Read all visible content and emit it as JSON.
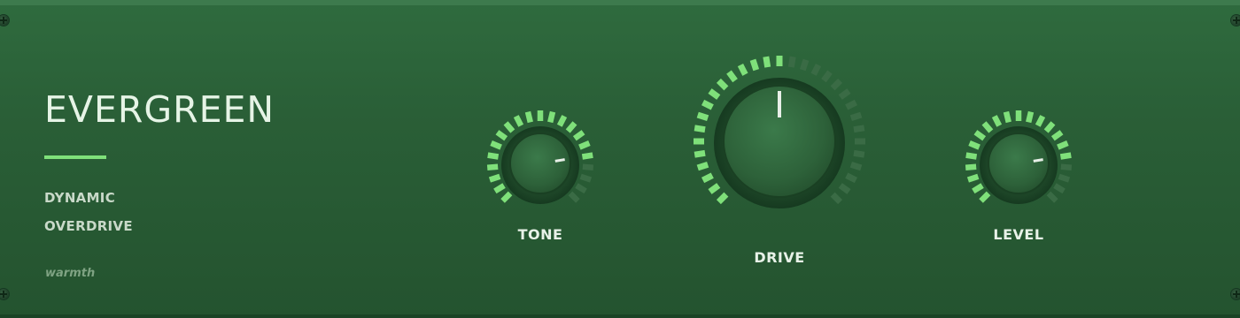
{
  "plugin": {
    "name": "EVERGREEN",
    "subtitle_line1": "DYNAMIC",
    "subtitle_line2": "OVERDRIVE",
    "tag": "warmth"
  },
  "colors": {
    "panel": "#2a5f37",
    "accent": "#7fe07a",
    "segment_off": "#3a6b45",
    "text": "#e6f4e6"
  },
  "knobs": [
    {
      "id": "tone",
      "label": "TONE",
      "value": 0.8
    },
    {
      "id": "drive",
      "label": "DRIVE",
      "value": 0.5
    },
    {
      "id": "level",
      "label": "LEVEL",
      "value": 0.8
    }
  ]
}
